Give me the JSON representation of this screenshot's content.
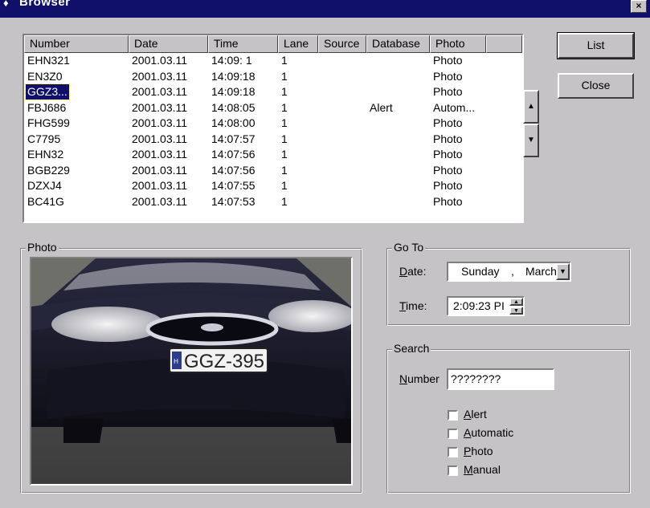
{
  "window": {
    "title": "Browser",
    "close_glyph": "×"
  },
  "list": {
    "columns": [
      {
        "key": "number",
        "label": "Number"
      },
      {
        "key": "date",
        "label": "Date"
      },
      {
        "key": "time",
        "label": "Time"
      },
      {
        "key": "lane",
        "label": "Lane"
      },
      {
        "key": "source",
        "label": "Source"
      },
      {
        "key": "database",
        "label": "Database"
      },
      {
        "key": "photo",
        "label": "Photo"
      }
    ],
    "rows": [
      {
        "number": "EHN321",
        "date": "2001.03.11",
        "time": "14:09: 1",
        "lane": "1",
        "source": "",
        "database": "",
        "photo": "Photo"
      },
      {
        "number": "EN3Z0",
        "date": "2001.03.11",
        "time": "14:09:18",
        "lane": "1",
        "source": "",
        "database": "",
        "photo": "Photo"
      },
      {
        "number": "GGZ3...",
        "date": "2001.03.11",
        "time": "14:09:18",
        "lane": "1",
        "source": "",
        "database": "",
        "photo": "Photo",
        "selected": true
      },
      {
        "number": "FBJ686",
        "date": "2001.03.11",
        "time": "14:08:05",
        "lane": "1",
        "source": "",
        "database": "Alert",
        "photo": "Autom..."
      },
      {
        "number": "FHG599",
        "date": "2001.03.11",
        "time": "14:08:00",
        "lane": "1",
        "source": "",
        "database": "",
        "photo": "Photo"
      },
      {
        "number": "C7795",
        "date": "2001.03.11",
        "time": "14:07:57",
        "lane": "1",
        "source": "",
        "database": "",
        "photo": "Photo"
      },
      {
        "number": "EHN32",
        "date": "2001.03.11",
        "time": "14:07:56",
        "lane": "1",
        "source": "",
        "database": "",
        "photo": "Photo"
      },
      {
        "number": "BGB229",
        "date": "2001.03.11",
        "time": "14:07:56",
        "lane": "1",
        "source": "",
        "database": "",
        "photo": "Photo"
      },
      {
        "number": "DZXJ4",
        "date": "2001.03.11",
        "time": "14:07:55",
        "lane": "1",
        "source": "",
        "database": "",
        "photo": "Photo"
      },
      {
        "number": "BC41G",
        "date": "2001.03.11",
        "time": "14:07:53",
        "lane": "1",
        "source": "",
        "database": "",
        "photo": "Photo"
      }
    ]
  },
  "buttons": {
    "list": "List",
    "close": "Close",
    "scroll_up": "▲",
    "scroll_down": "▼"
  },
  "photo_group": {
    "label": "Photo",
    "plate_text": "GGZ-395",
    "plate_prefix": "H"
  },
  "goto": {
    "label": "Go To",
    "date_label_key": "D",
    "date_label_rest": "ate:",
    "date_day": "Sunday",
    "date_sep": ",",
    "date_month": "March",
    "time_label_key": "T",
    "time_label_rest": "ime:",
    "time_value": "2:09:23 PI"
  },
  "search": {
    "label": "Search",
    "number_label_key": "N",
    "number_label_rest": "umber",
    "number_value": "????????",
    "checkboxes": [
      {
        "key": "A",
        "rest": "lert",
        "checked": false
      },
      {
        "key": "A",
        "rest": "utomatic",
        "checked": false
      },
      {
        "key": "P",
        "rest": "hoto",
        "checked": false
      },
      {
        "key": "M",
        "rest": "anual",
        "checked": false
      }
    ]
  }
}
